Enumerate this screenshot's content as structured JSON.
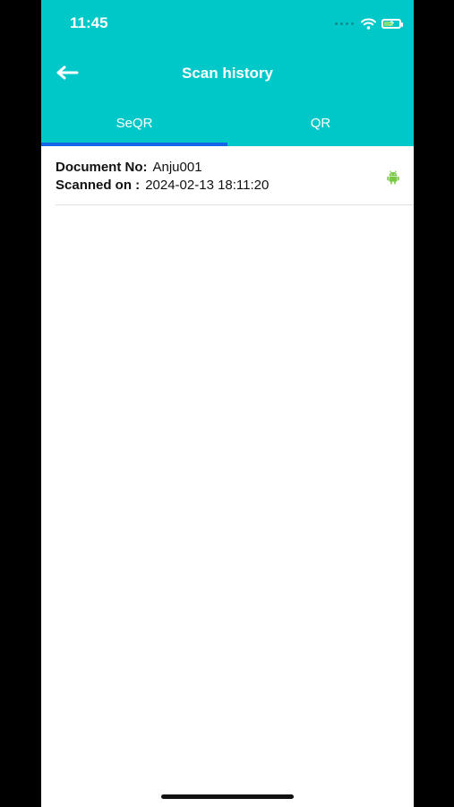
{
  "status_bar": {
    "time": "11:45",
    "wifi_icon": "wifi-icon",
    "battery_icon": "battery-charging-icon"
  },
  "header": {
    "title": "Scan history",
    "back_icon": "back-arrow-icon"
  },
  "tabs": [
    {
      "label": "SeQR",
      "active": true
    },
    {
      "label": "QR",
      "active": false
    }
  ],
  "history": [
    {
      "document_label": "Document No:",
      "document_value": "Anju001",
      "scanned_label": "Scanned on :",
      "scanned_value": "2024-02-13 18:11:20",
      "platform_icon": "android-icon"
    }
  ],
  "colors": {
    "header": "#00c8c8",
    "tab_indicator": "#1565e6",
    "android": "#7ac943"
  }
}
